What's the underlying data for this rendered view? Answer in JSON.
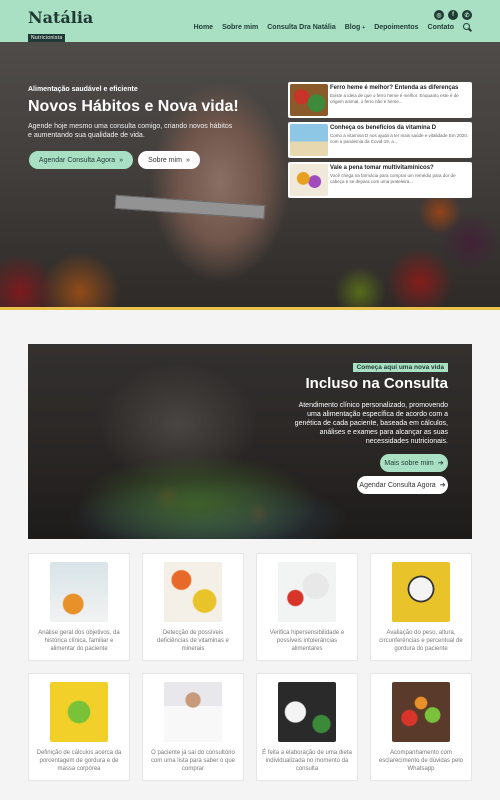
{
  "header": {
    "logo_name": "Natália",
    "logo_tag": "Nutricionista",
    "nav": [
      "Home",
      "Sobre mim",
      "Consulta Dra Natália",
      "Blog",
      "Depoimentos",
      "Contato"
    ],
    "social": [
      "instagram-icon",
      "facebook-icon",
      "whatsapp-icon"
    ]
  },
  "hero": {
    "kicker": "Alimentação saudável e eficiente",
    "title": "Novos Hábitos e Nova vida!",
    "description": "Agende hoje mesmo uma consulta comigo, criando novos hábitos e aumentando sua qualidade de vida.",
    "btn_schedule": "Agendar Consulta Agora",
    "btn_about": "Sobre mim",
    "posts": [
      {
        "title": "Ferro heme é melhor? Entenda as diferenças",
        "excerpt": "Existe a ideia de que o ferro heme é melhor. Enquanto este é de origem animal, o ferro não é heme..."
      },
      {
        "title": "Conheça os benefícios da vitamina D",
        "excerpt": "Como a vitamina D nos ajuda a ter mais saúde e vitalidade Em 2020, com a pandemia da Covid-19, a..."
      },
      {
        "title": "Vale a pena tomar multivitamínicos?",
        "excerpt": "Você chega na farmácia para comprar um remédio para dor de cabeça e se depara com uma prateleira..."
      }
    ]
  },
  "included": {
    "tag": "Começa aqui uma nova vida",
    "title": "Incluso na Consulta",
    "description": "Atendimento clínico personalizado, promovendo uma alimentação específica de acordo com a genética de cada paciente, baseada em cálculos, análises e exames para alcançar as suas necessidades nutricionais.",
    "btn_more": "Mais sobre mim",
    "btn_schedule": "Agendar Consulta Agora"
  },
  "cards": [
    "Análise geral dos objetivos, da histórica clínica, familiar e alimentar do paciente",
    "Detecção de possíveis deficiências de vitaminas e minerais",
    "Verifica hipersensibilidade e possíveis intolerâncias alimentares",
    "Avaliação do peso, altura, circunferências e percentual de gordura do paciente",
    "Definição de cálculos acerca da porcentagem de gordura e de massa corpórea",
    "O paciente já sai do consultório com uma lista para saber o que comprar",
    "É feita a elaboração de uma dieta individualizada no momento da consulta",
    "Acompanhamento com esclarecimento de dúvidas pelo Whatsapp"
  ],
  "colors": {
    "accent": "#a9e0c3",
    "dark": "#1f3a34"
  }
}
